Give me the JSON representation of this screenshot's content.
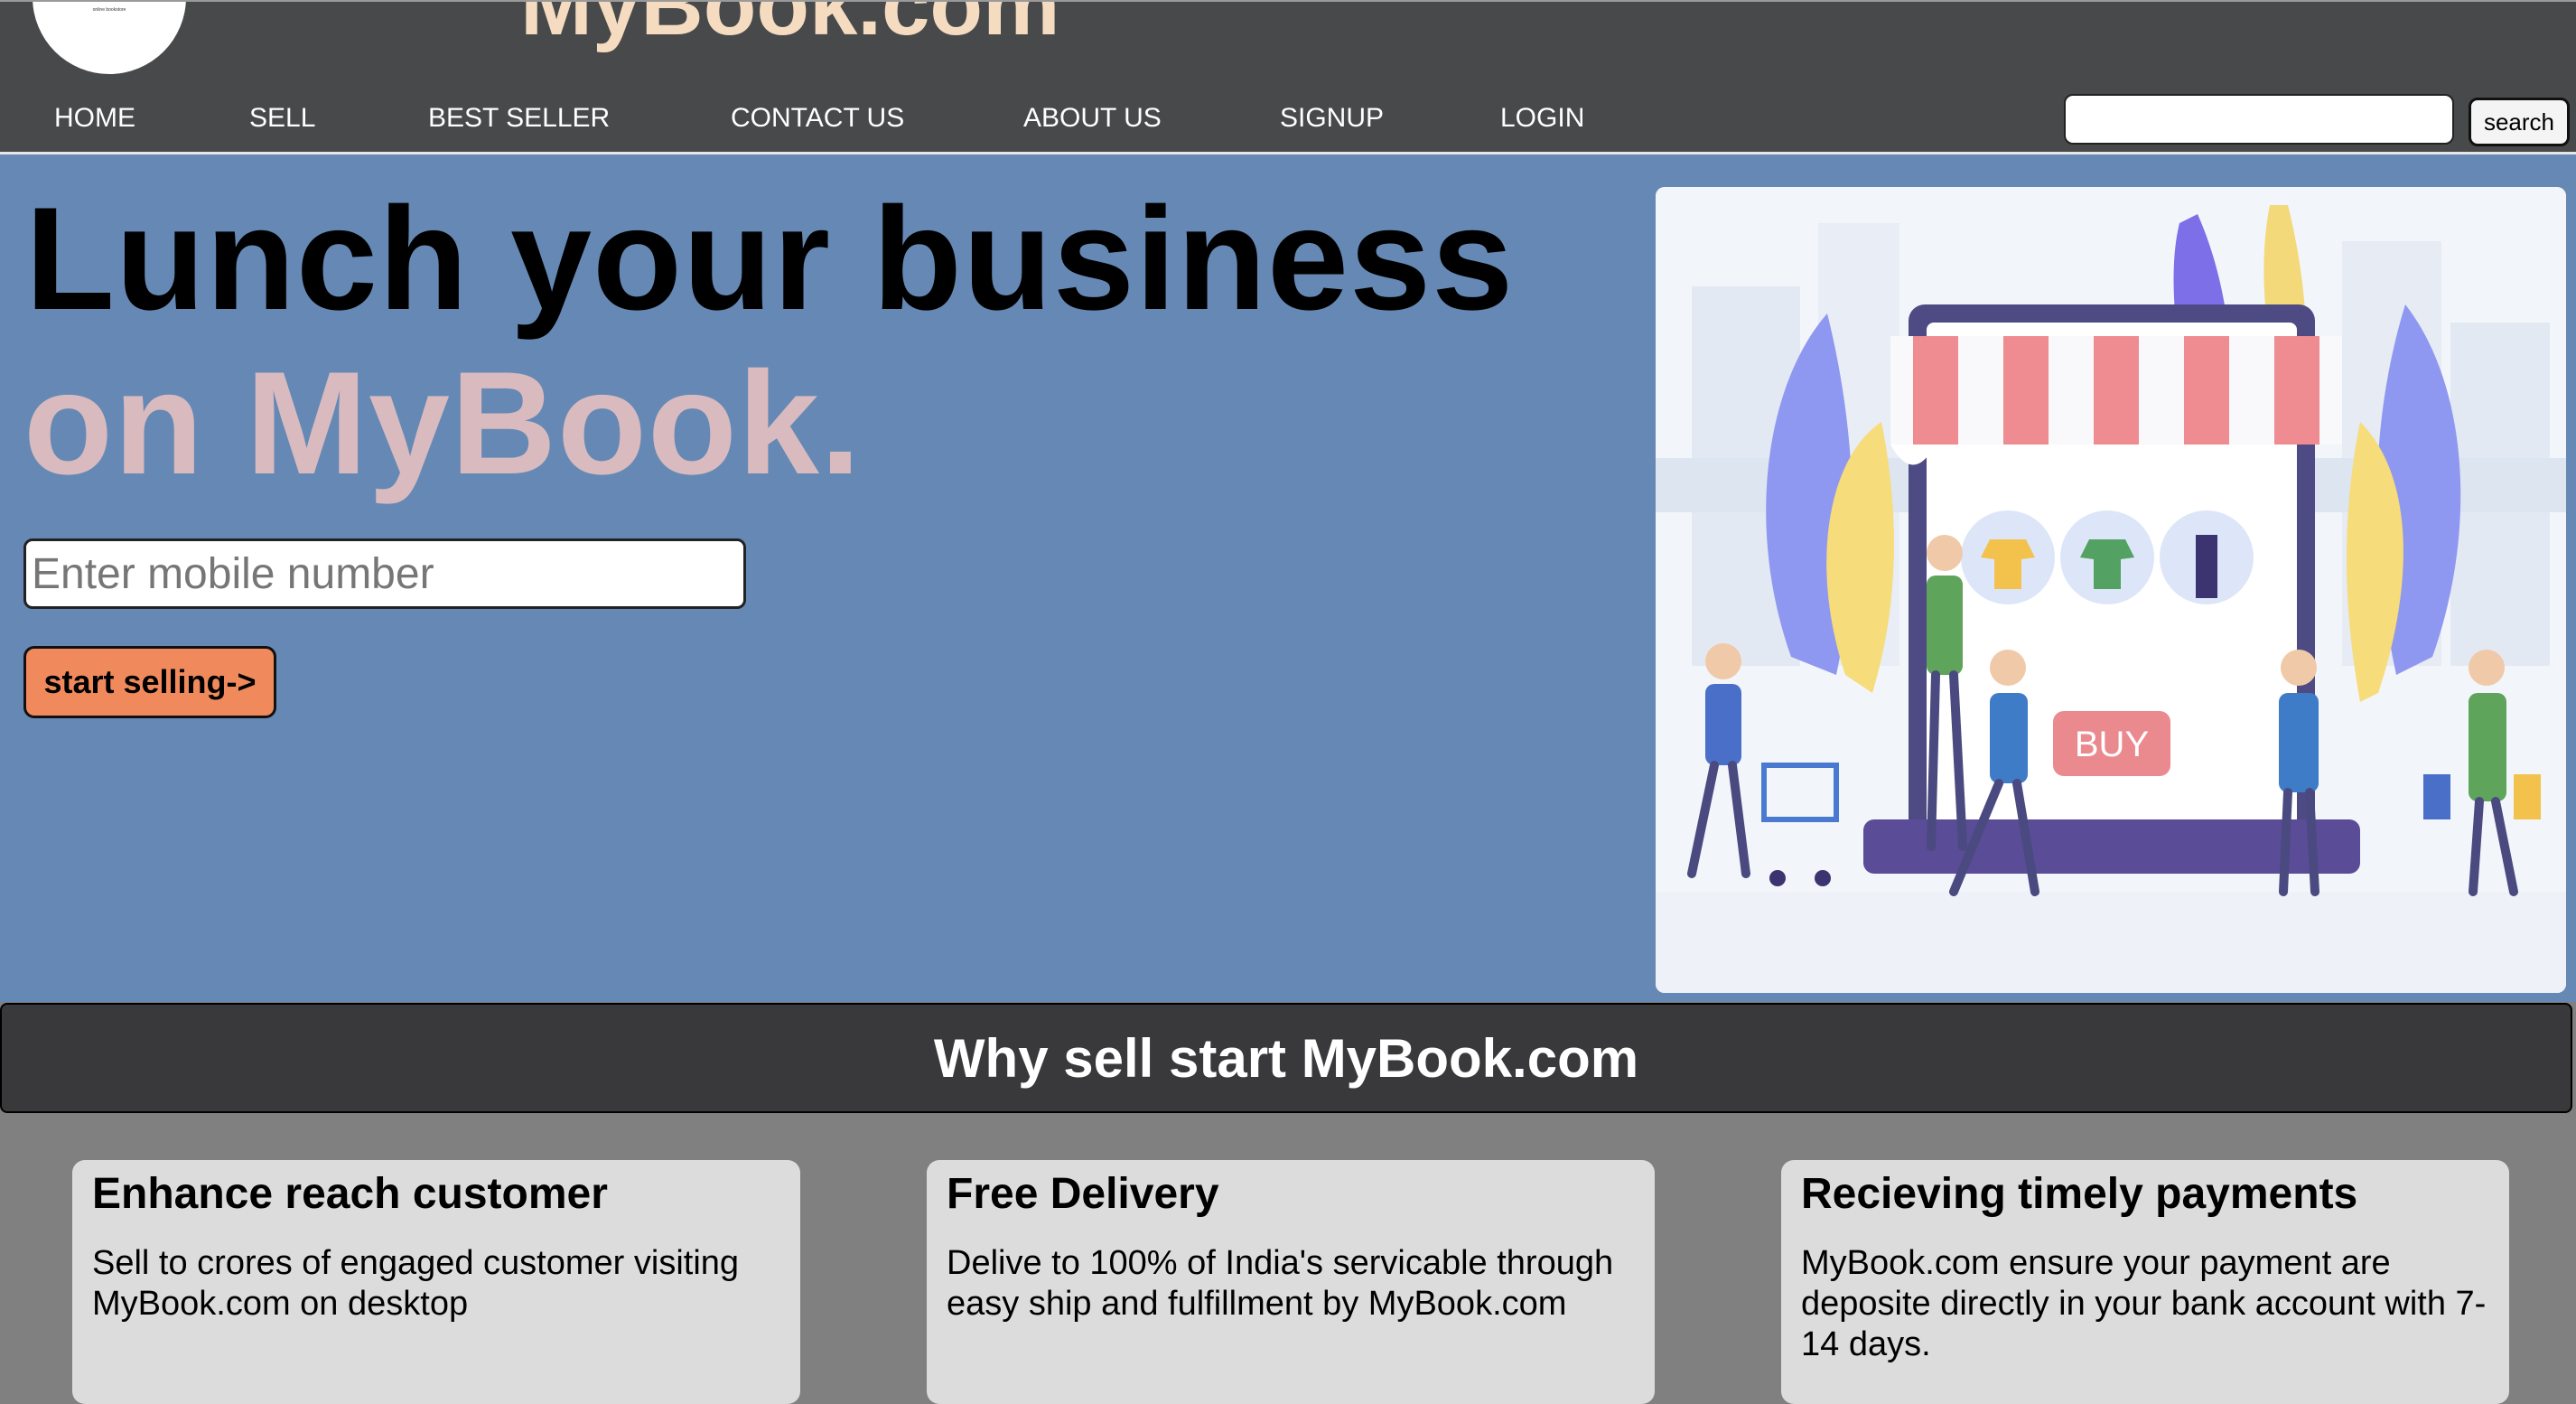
{
  "header": {
    "brand": "MyBook.com",
    "logo_tagline": "online bookstore"
  },
  "nav": {
    "items": [
      {
        "label": "HOME"
      },
      {
        "label": "SELL"
      },
      {
        "label": "BEST SELLER"
      },
      {
        "label": "CONTACT US"
      },
      {
        "label": "ABOUT US"
      },
      {
        "label": "SIGNUP"
      },
      {
        "label": "LOGIN"
      }
    ],
    "search": {
      "value": "",
      "placeholder": "",
      "button_label": "search"
    }
  },
  "hero": {
    "headline_1": "Lunch your business",
    "headline_2": "on MyBook.",
    "mobile_input": {
      "value": "",
      "placeholder": "Enter mobile number"
    },
    "cta_label": "start selling->",
    "image": {
      "buy_label": "BUY"
    }
  },
  "why": {
    "title": "Why sell start MyBook.com"
  },
  "cards": [
    {
      "title": "Enhance reach customer",
      "text": "Sell to crores of engaged customer visiting MyBook.com on desktop"
    },
    {
      "title": "Free Delivery",
      "text": "Delive to 100% of India's servicable through easy ship and fulfillment by MyBook.com"
    },
    {
      "title": "Recieving timely payments",
      "text": "MyBook.com ensure your payment are deposite directly in your bank account with 7-14 days."
    }
  ],
  "colors": {
    "header_bg": "#48494b",
    "brand": "#f5dcc1",
    "hero_bg": "#6589b4",
    "hero_accent": "#d8babf",
    "cta": "#f08a5d",
    "banner_bg": "#39383a",
    "page_bg": "#808080",
    "card_bg": "#dcdcdc"
  }
}
